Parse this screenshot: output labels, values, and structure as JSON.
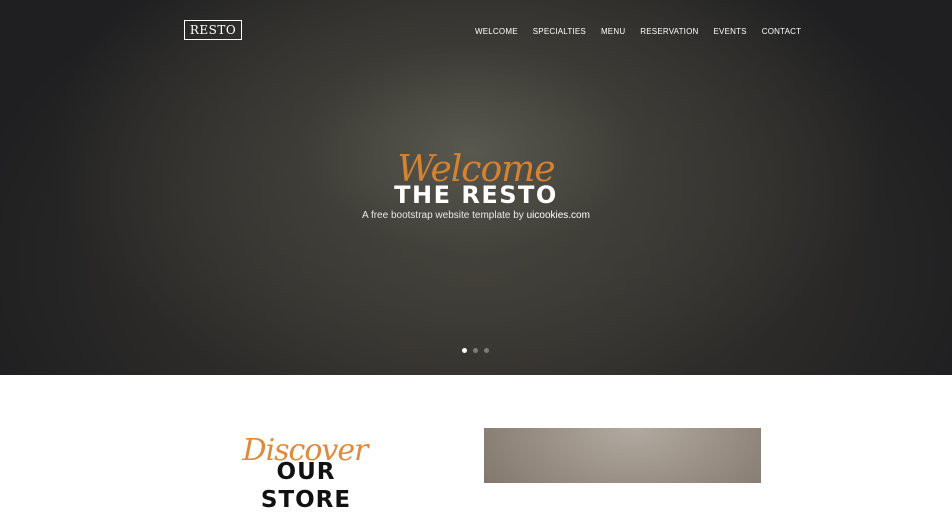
{
  "header": {
    "logo": "RESTO",
    "nav": [
      "WELCOME",
      "SPECIALTIES",
      "MENU",
      "RESERVATION",
      "EVENTS",
      "CONTACT"
    ]
  },
  "hero": {
    "script_text": "Welcome",
    "title": "THE RESTO",
    "subtitle_prefix": "A free bootstrap website template by ",
    "subtitle_link": "uicookies.com",
    "slides": 3,
    "active_slide": 1
  },
  "store": {
    "script_text": "Discover",
    "title": "OUR STORE"
  },
  "colors": {
    "accent": "#d7822e",
    "hero_dark": "#1f1f21",
    "text_dark": "#111111"
  }
}
